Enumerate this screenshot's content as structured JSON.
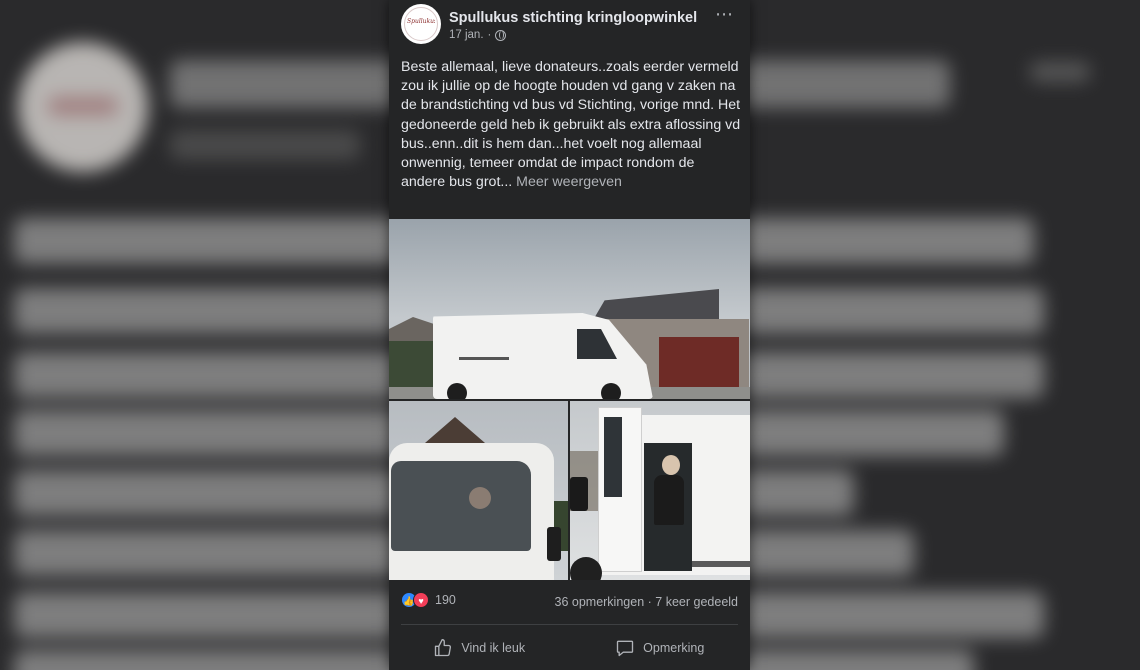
{
  "post": {
    "page_name": "Spullukus stichting kringloopwinkel",
    "date": "17 jan.",
    "separator": "·",
    "text": "Beste allemaal, lieve donateurs..zoals eerder vermeld zou ik jullie op de hoogte houden vd gang v zaken na de brandstichting vd bus vd Stichting, vorige mnd. Het gedoneerde geld heb ik gebruikt als extra aflossing vd bus..enn..dit is hem dan...het voelt nog allemaal onwennig, temeer omdat de impact rondom de andere bus grot...",
    "see_more": "Meer weergeven",
    "avatar_logo_text": "Spullukus",
    "more_icon": "⋯"
  },
  "reactions": {
    "count": "190",
    "icons": [
      "like-icon",
      "love-icon"
    ],
    "comments": "36 opmerkingen",
    "dot": "·",
    "shares": "7 keer gedeeld"
  },
  "actions": {
    "like_label": "Vind ik leuk",
    "comment_label": "Opmerking"
  },
  "colors": {
    "background": "#242526",
    "text": "#e4e6eb",
    "muted": "#b0b3b8",
    "like_blue": "#2d88ff",
    "love_red": "#f33e58"
  }
}
